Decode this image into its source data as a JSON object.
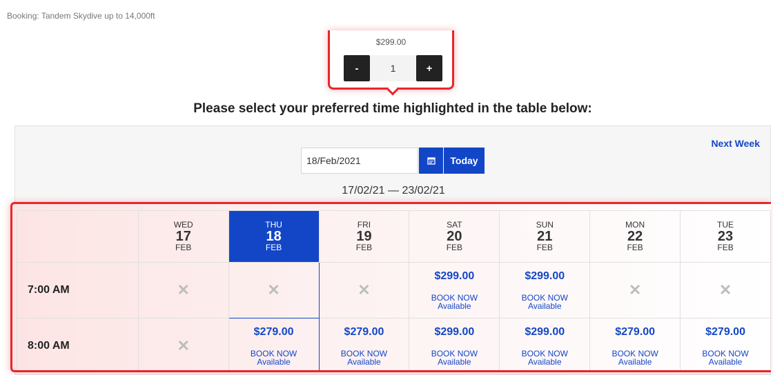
{
  "breadcrumb": "Booking: Tandem Skydive up to 14,000ft",
  "quantity": {
    "price": "$299.00",
    "minus_label": "-",
    "value": "1",
    "plus_label": "+"
  },
  "heading": "Please select your preferred time highlighted in the table below:",
  "calendar": {
    "next_week_label": "Next Week",
    "date_value": "18/Feb/2021",
    "today_label": "Today",
    "range": "17/02/21 — 23/02/21"
  },
  "days": [
    {
      "dow": "WED",
      "num": "17",
      "mon": "FEB"
    },
    {
      "dow": "THU",
      "num": "18",
      "mon": "FEB"
    },
    {
      "dow": "FRI",
      "num": "19",
      "mon": "FEB"
    },
    {
      "dow": "SAT",
      "num": "20",
      "mon": "FEB"
    },
    {
      "dow": "SUN",
      "num": "21",
      "mon": "FEB"
    },
    {
      "dow": "MON",
      "num": "22",
      "mon": "FEB"
    },
    {
      "dow": "TUE",
      "num": "23",
      "mon": "FEB"
    }
  ],
  "slots": [
    {
      "time": "7:00 AM",
      "cells": [
        {
          "price": "",
          "book": "",
          "avail": ""
        },
        {
          "price": "",
          "book": "",
          "avail": ""
        },
        {
          "price": "",
          "book": "",
          "avail": ""
        },
        {
          "price": "$299.00",
          "book": "BOOK NOW",
          "avail": "Available"
        },
        {
          "price": "$299.00",
          "book": "BOOK NOW",
          "avail": "Available"
        },
        {
          "price": "",
          "book": "",
          "avail": ""
        },
        {
          "price": "",
          "book": "",
          "avail": ""
        }
      ]
    },
    {
      "time": "8:00 AM",
      "cells": [
        {
          "price": "",
          "book": "",
          "avail": ""
        },
        {
          "price": "$279.00",
          "book": "BOOK NOW",
          "avail": "Available"
        },
        {
          "price": "$279.00",
          "book": "BOOK NOW",
          "avail": "Available"
        },
        {
          "price": "$299.00",
          "book": "BOOK NOW",
          "avail": "Available"
        },
        {
          "price": "$299.00",
          "book": "BOOK NOW",
          "avail": "Available"
        },
        {
          "price": "$279.00",
          "book": "BOOK NOW",
          "avail": "Available"
        },
        {
          "price": "$279.00",
          "book": "BOOK NOW",
          "avail": "Available"
        }
      ]
    }
  ],
  "unavailable_mark": "✕",
  "colors": {
    "accent": "#1346c7",
    "highlight": "#e8262b",
    "unavailable": "#bdbdbd"
  },
  "icons": {
    "calendar": "calendar-icon",
    "unavailable": "cross-icon"
  }
}
